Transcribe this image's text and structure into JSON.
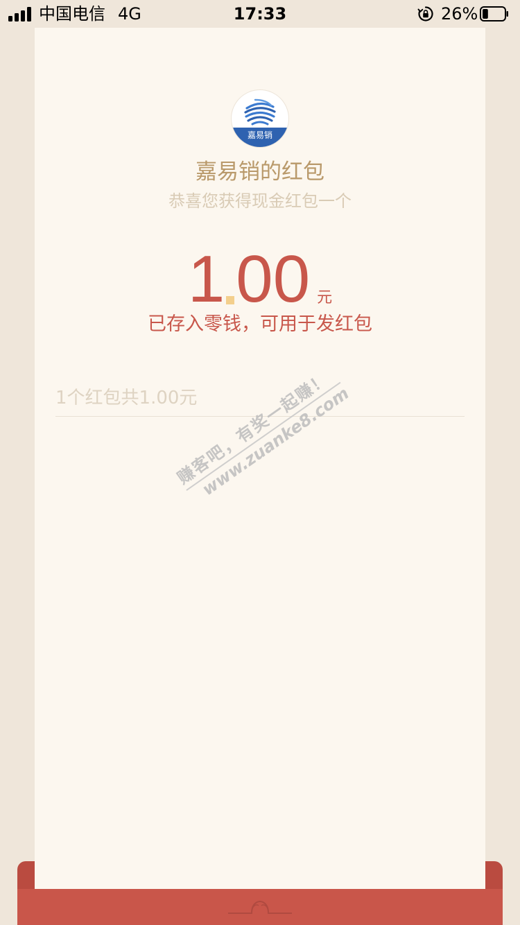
{
  "status_bar": {
    "carrier": "中国电信",
    "network": "4G",
    "time": "17:33",
    "battery": "26%",
    "battery_level": 0.26
  },
  "red_packet": {
    "logo_text": "嘉易销",
    "title": "嘉易销的红包",
    "greeting": "恭喜您获得现金红包一个",
    "amount_integer": "1",
    "amount_decimal": "00",
    "amount_unit": "元",
    "saved_note": "已存入零钱，可用于发红包",
    "summary": "1个红包共1.00元"
  },
  "watermark": {
    "line1": "赚客吧，有奖一起赚！",
    "line2": "www.zuanke8.com"
  },
  "colors": {
    "accent_red": "#c8574b",
    "title_gold": "#b9996a",
    "paper": "#fcf7ef"
  },
  "icons": {
    "signal": "signal-icon",
    "rotation_lock": "rotation-lock-icon",
    "battery": "battery-icon",
    "envelope_hinge": "envelope-hinge-icon"
  }
}
